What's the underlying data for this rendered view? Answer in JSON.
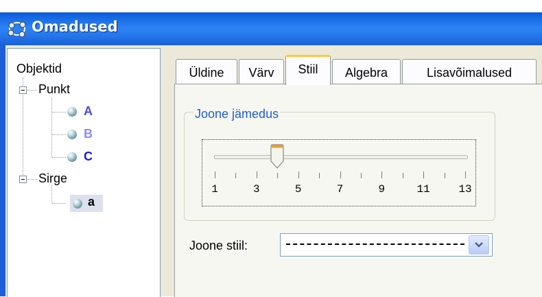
{
  "window": {
    "title": "Omadused"
  },
  "tree": {
    "root_label": "Objektid",
    "groups": [
      {
        "label": "Punkt",
        "items": [
          {
            "label": "A",
            "color": "#4a4ae0"
          },
          {
            "label": "B",
            "color": "#8c8cf0"
          },
          {
            "label": "C",
            "color": "#1a1ae8"
          }
        ]
      },
      {
        "label": "Sirge",
        "items": [
          {
            "label": "a",
            "color": "#000000",
            "selected": true
          }
        ]
      }
    ]
  },
  "tabs": [
    {
      "label": "Üldine",
      "active": false
    },
    {
      "label": "Värv",
      "active": false
    },
    {
      "label": "Stiil",
      "active": true
    },
    {
      "label": "Algebra",
      "active": false
    },
    {
      "label": "Lisavõimalused",
      "active": false
    }
  ],
  "style_tab": {
    "line_thickness_label": "Joone jämedus",
    "slider": {
      "min": 1,
      "max": 13,
      "value": 4,
      "tick_labels": [
        "1",
        "3",
        "5",
        "7",
        "9",
        "11",
        "13"
      ]
    },
    "line_style_label": "Joone stiil:",
    "line_style_value": "dashed"
  },
  "colors": {
    "accent": "#1b5fd0",
    "titlebar": "#2a7ef0",
    "active_tab_highlight": "#ffc83c"
  },
  "icons": [
    "window-app-icon",
    "tree-expander-icon",
    "point-ball-icon",
    "dropdown-arrow-icon"
  ]
}
